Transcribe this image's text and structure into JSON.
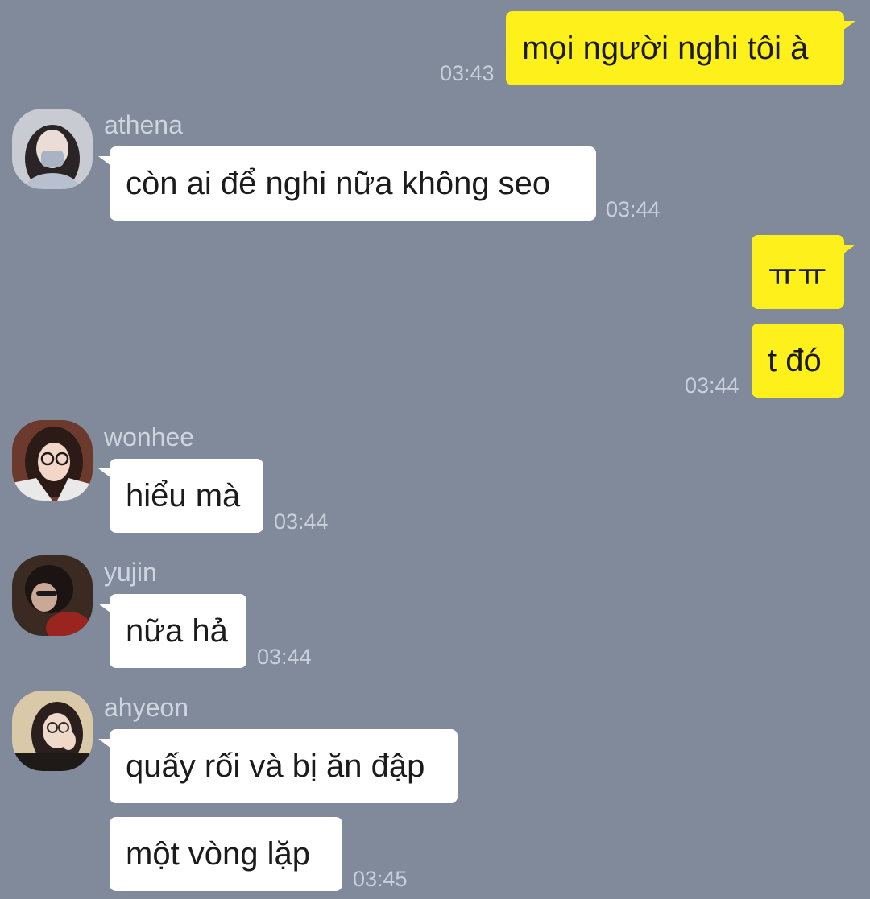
{
  "messages": {
    "m1": {
      "text": "mọi người nghi tôi à",
      "time": "03:43"
    },
    "m2": {
      "sender": "athena",
      "text": "còn ai để nghi nữa không seo",
      "time": "03:44"
    },
    "m3": {
      "text": "ㅠㅠ"
    },
    "m4": {
      "text": "t đó",
      "time": "03:44"
    },
    "m5": {
      "sender": "wonhee",
      "text": "hiểu mà",
      "time": "03:44"
    },
    "m6": {
      "sender": "yujin",
      "text": "nữa hả",
      "time": "03:44"
    },
    "m7": {
      "sender": "ahyeon",
      "text": "quấy rối và bị ăn đập"
    },
    "m8": {
      "text": "một vòng lặp",
      "time": "03:45"
    }
  },
  "colors": {
    "background": "#808a9b",
    "outgoing_bubble": "#fef01b",
    "incoming_bubble": "#ffffff"
  },
  "icons": {
    "athena": "avatar-photo",
    "wonhee": "avatar-photo",
    "yujin": "avatar-photo",
    "ahyeon": "avatar-photo"
  }
}
